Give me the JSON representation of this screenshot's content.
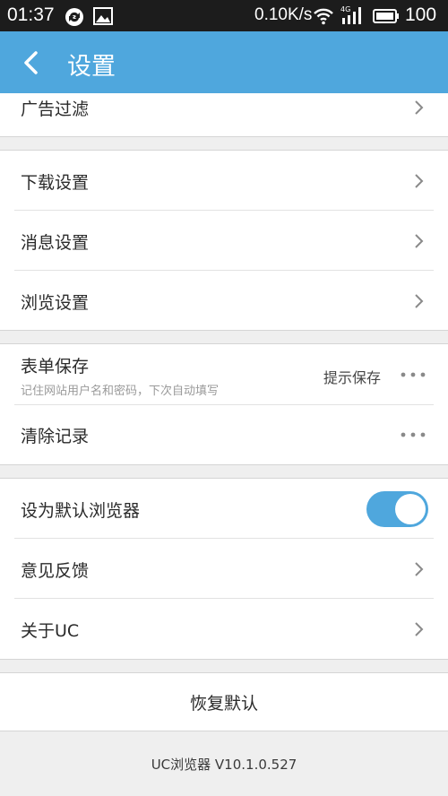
{
  "status_bar": {
    "time": "01:37",
    "speed": "0.10K/s",
    "battery": "100",
    "icons": [
      "sync-icon",
      "image-icon",
      "wifi-icon",
      "signal-4g-icon",
      "battery-icon"
    ]
  },
  "header": {
    "title": "设置",
    "background": "#4fa7dd"
  },
  "settings": {
    "ad_filter": "广告过滤",
    "download": "下载设置",
    "message": "消息设置",
    "browse": "浏览设置",
    "form_save": {
      "label": "表单保存",
      "sublabel": "记住网站用户名和密码，下次自动填写",
      "value": "提示保存"
    },
    "clear_records": "清除记录",
    "default_browser": {
      "label": "设为默认浏览器",
      "enabled": true
    },
    "feedback": "意见反馈",
    "about": "关于UC"
  },
  "reset_label": "恢复默认",
  "version": "UC浏览器 V10.1.0.527",
  "accent_color": "#4fa7dd"
}
